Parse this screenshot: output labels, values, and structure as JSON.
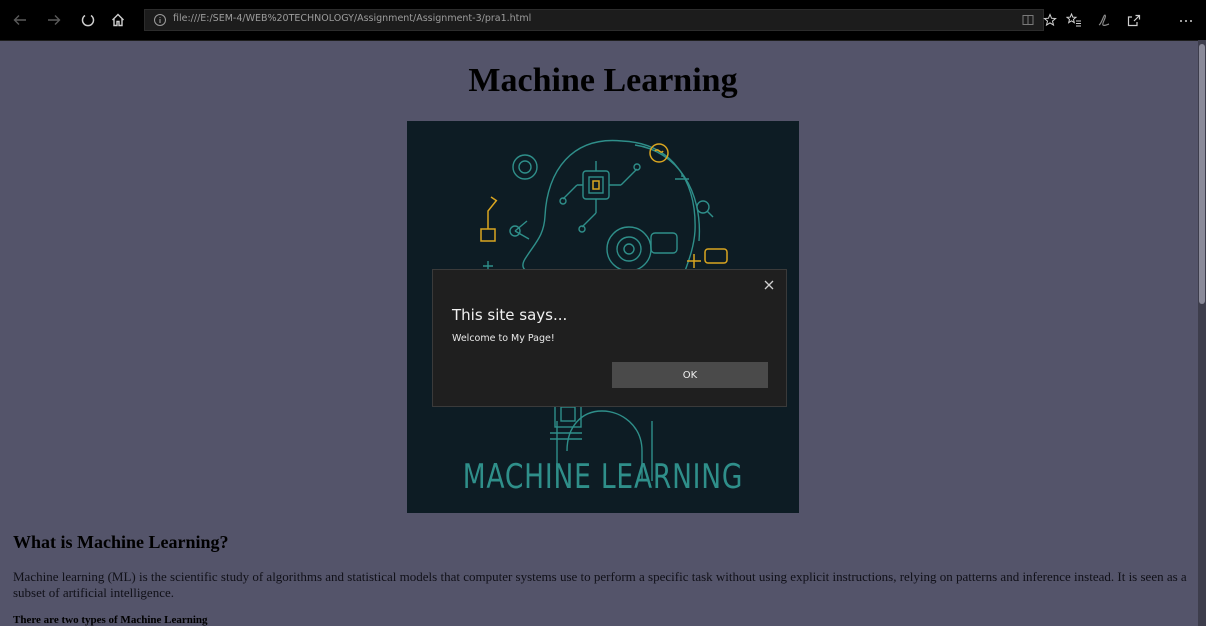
{
  "browser": {
    "url": "file:///E:/SEM-4/WEB%20TECHNOLOGY/Assignment/Assignment-3/pra1.html",
    "toolbar_icons": [
      "back-icon",
      "forward-icon",
      "refresh-icon",
      "home-icon",
      "reading-view-icon",
      "favorite-star-icon",
      "favorites-icon",
      "pen-icon",
      "share-icon",
      "more-icon"
    ]
  },
  "page": {
    "title": "Machine Learning",
    "image_caption": "MACHINE LEARNING",
    "section_heading": "What is Machine Learning?",
    "description": "Machine learning (ML) is the scientific study of algorithms and statistical models that computer systems use to perform a specific task without using explicit instructions, relying on patterns and inference instead. It is seen as a subset of artificial intelligence.",
    "types_line": "There are two types of Machine Learning"
  },
  "dialog": {
    "title": "This site says...",
    "message": "Welcome to My Page!",
    "ok_label": "OK"
  },
  "colors": {
    "page_background": "#54546a",
    "dialog_background": "#1f1f1f",
    "image_background": "#0d1c24",
    "image_line": "#2f8f8a",
    "image_accent": "#d9a520"
  }
}
